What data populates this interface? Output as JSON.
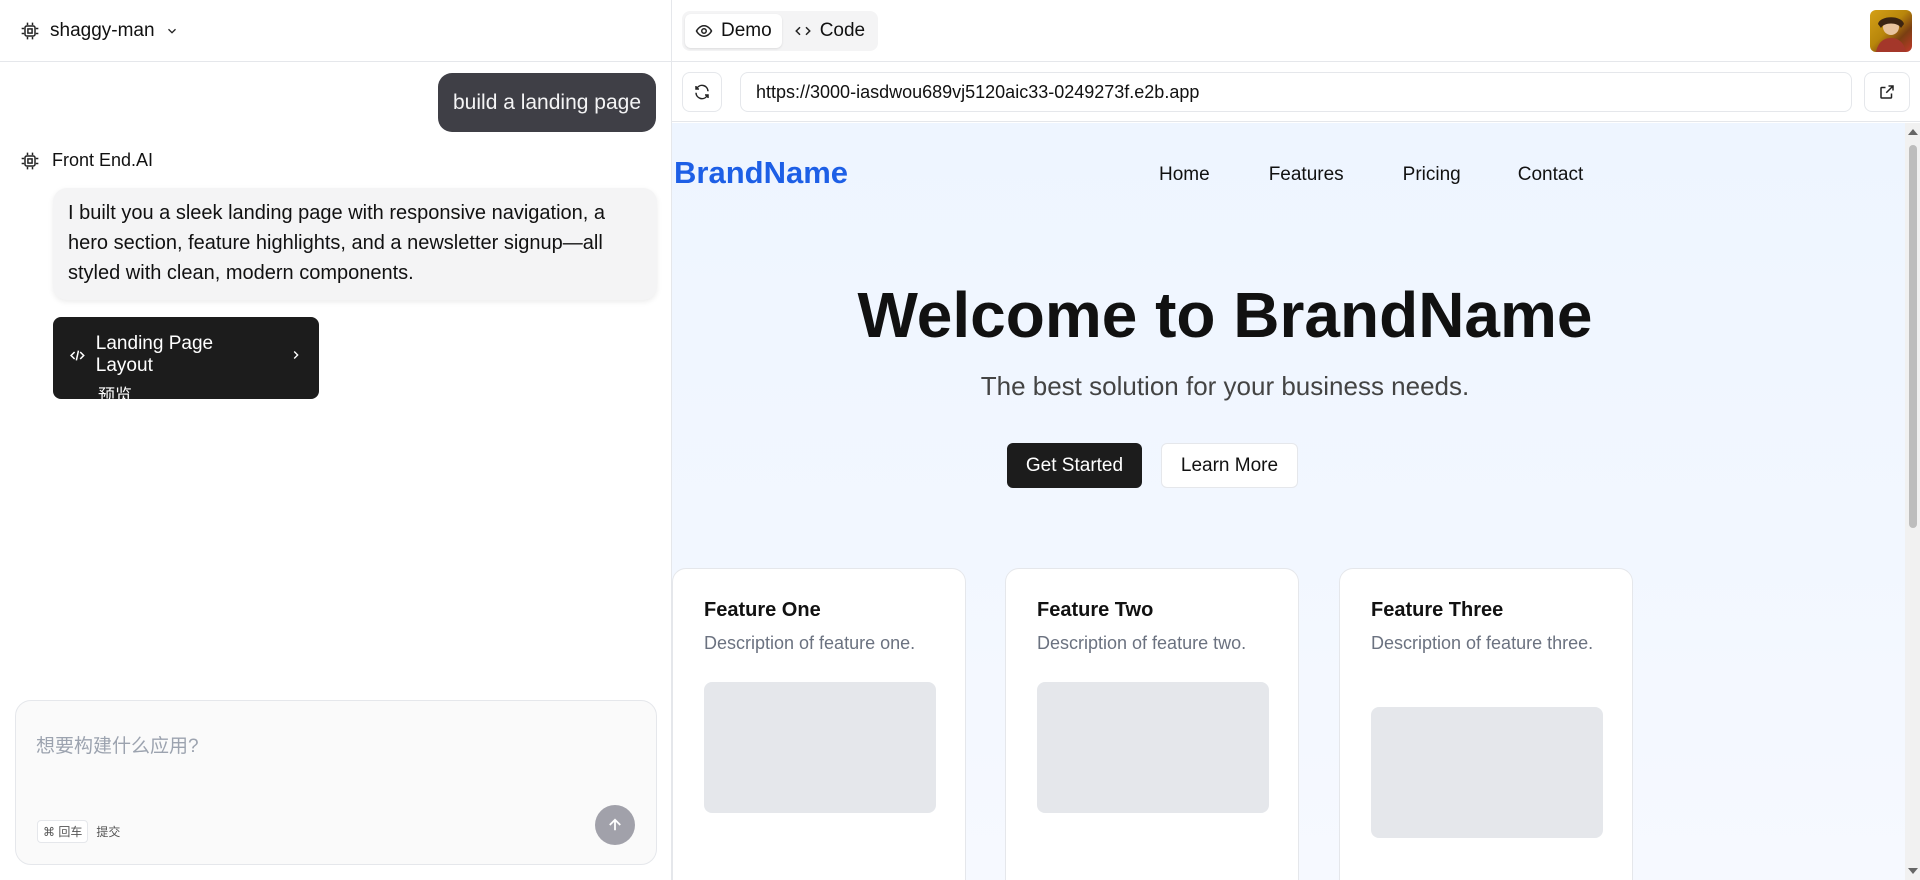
{
  "left_header": {
    "project_name": "shaggy-man"
  },
  "chat": {
    "user_message": "build a landing page",
    "assistant_name": "Front End.AI",
    "assistant_message": "I built you a sleek landing page with responsive navigation, a hero section, feature highlights, and a newsletter signup—all styled with clean, modern components.",
    "artifact": {
      "title": "Landing Page Layout",
      "subtitle": "预览"
    }
  },
  "composer": {
    "placeholder": "想要构建什么应用?",
    "shortcut_key": "回车",
    "submit_label": "提交"
  },
  "right_header": {
    "tabs": [
      {
        "label": "Demo",
        "icon": "eye-icon"
      },
      {
        "label": "Code",
        "icon": "code-icon"
      }
    ]
  },
  "url_bar": {
    "url": "https://3000-iasdwou689vj5120aic33-0249273f.e2b.app"
  },
  "preview": {
    "brand": "BrandName",
    "nav": [
      "Home",
      "Features",
      "Pricing",
      "Contact"
    ],
    "hero_title": "Welcome to BrandName",
    "hero_subtitle": "The best solution for your business needs.",
    "primary_cta": "Get Started",
    "secondary_cta": "Learn More",
    "features": [
      {
        "title": "Feature One",
        "description": "Description of feature one."
      },
      {
        "title": "Feature Two",
        "description": "Description of feature two."
      },
      {
        "title": "Feature Three",
        "description": "Description of feature three."
      }
    ]
  },
  "colors": {
    "brand_blue": "#1d5fe6",
    "dark": "#1c1c1c",
    "user_bubble": "#3f3f46"
  }
}
